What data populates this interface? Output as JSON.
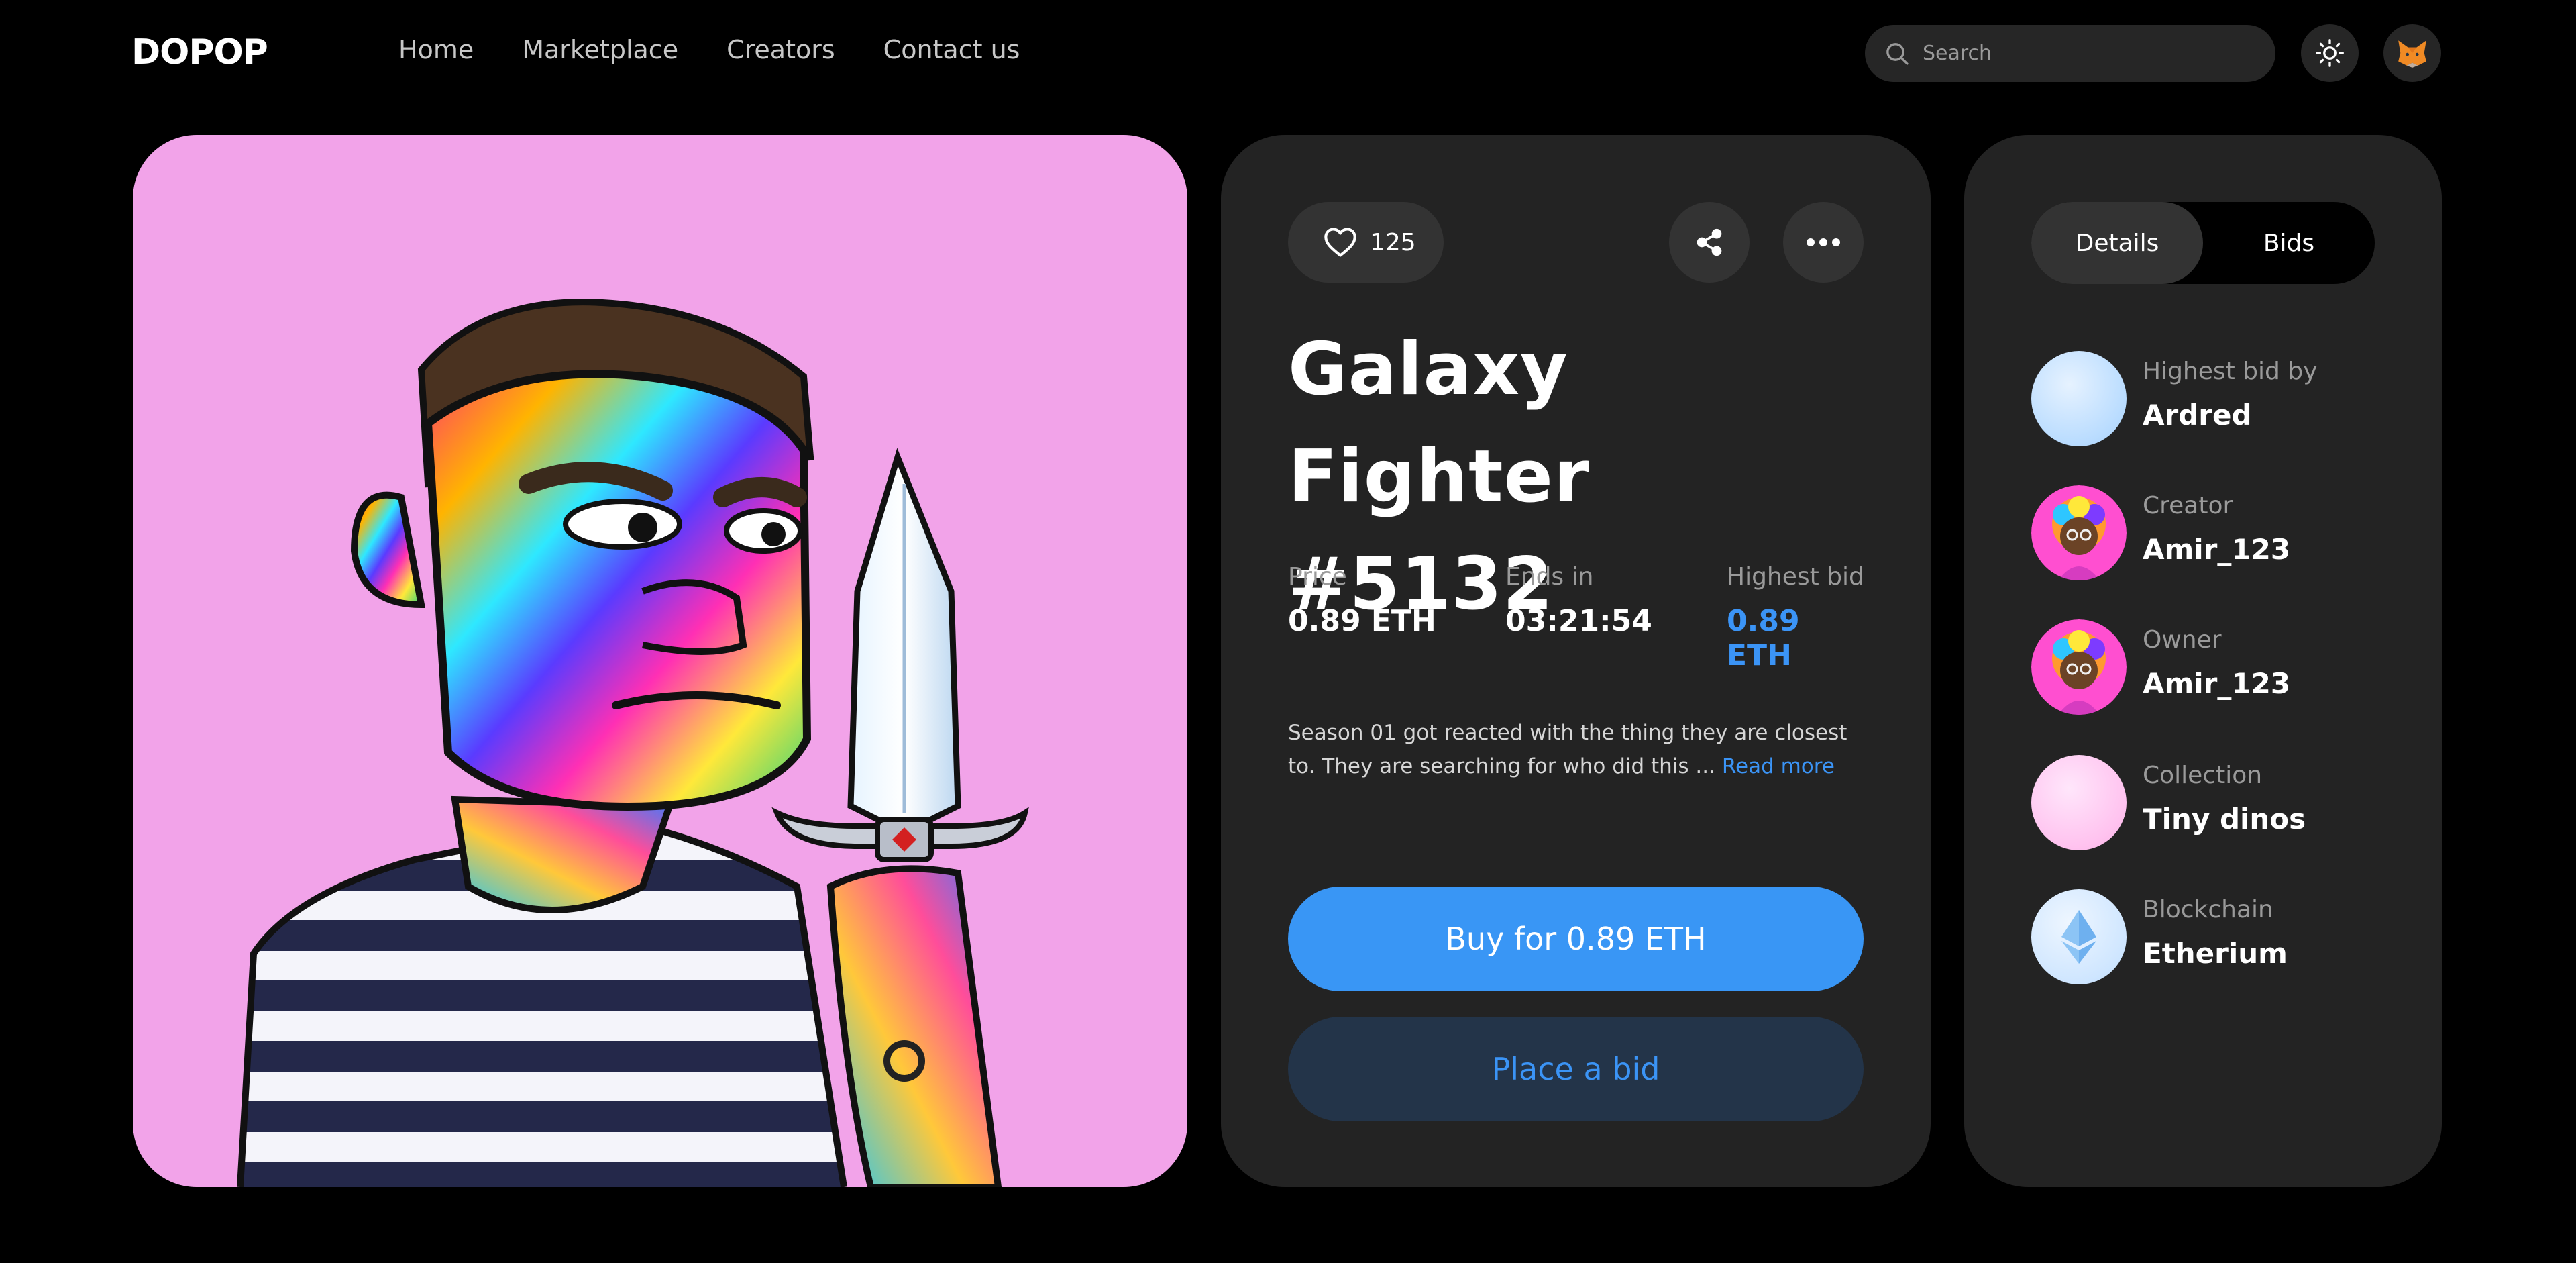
{
  "header": {
    "logo": "DOPOP",
    "nav": [
      "Home",
      "Marketplace",
      "Creators",
      "Contact us"
    ],
    "search_placeholder": "Search"
  },
  "artwork": {
    "background_color": "#f2a3e9"
  },
  "item": {
    "likes": "125",
    "title_line1": "Galaxy Fighter",
    "title_line2": "#5132",
    "stats": {
      "price_label": "Price",
      "price_value": "0.89 ETH",
      "ends_label": "Ends in",
      "ends_value": "03:21:54",
      "bid_label": "Highest bid",
      "bid_value": "0.89 ETH"
    },
    "description": "Season 01 got reacted with the thing they are closest to. They are searching for who did this ... ",
    "read_more": "Read more",
    "buy_label": "Buy for 0.89 ETH",
    "bid_button_label": "Place a bid"
  },
  "side": {
    "tabs": [
      "Details",
      "Bids"
    ],
    "rows": [
      {
        "label": "Highest bid by",
        "value": "Ardred"
      },
      {
        "label": "Creator",
        "value": "Amir_123"
      },
      {
        "label": "Owner",
        "value": "Amir_123"
      },
      {
        "label": "Collection",
        "value": "Tiny dinos"
      },
      {
        "label": "Blockchain",
        "value": "Etherium"
      }
    ]
  },
  "colors": {
    "accent": "#3996f5",
    "card_bg": "#232323",
    "page_bg": "#000000"
  },
  "icons": [
    "search-icon",
    "sun-icon",
    "fox-icon",
    "heart-icon",
    "share-icon",
    "more-icon",
    "ethereum-icon"
  ]
}
